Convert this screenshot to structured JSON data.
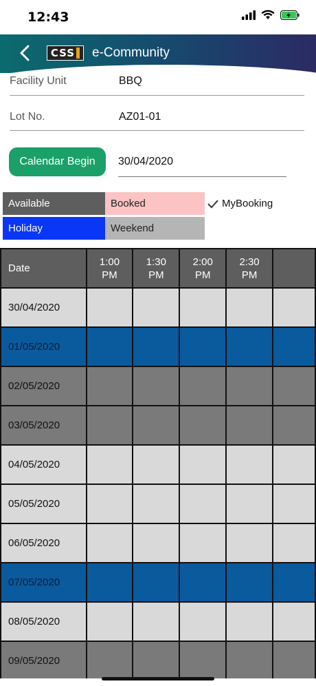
{
  "status_bar": {
    "time": "12:43"
  },
  "header": {
    "title": "e-Community",
    "logo_text": "CSS"
  },
  "form": {
    "facility_unit": {
      "label": "Facility Unit",
      "value": "BBQ"
    },
    "lot_no": {
      "label": "Lot No.",
      "value": "AZ01-01"
    }
  },
  "calendar": {
    "button_label": "Calendar Begin",
    "date": "30/04/2020"
  },
  "legend": {
    "available": "Available",
    "booked": "Booked",
    "mybooking": "MyBooking",
    "holiday": "Holiday",
    "weekend": "Weekend"
  },
  "colors": {
    "header_start": "#0b6b6e",
    "header_end": "#2c2a63",
    "button_green": "#1aa068",
    "available": "#5e5e5e",
    "booked": "#fbc3c3",
    "holiday": "#0a36f5",
    "holiday_row": "#0a5a9e",
    "weekend": "#b5b5b5",
    "weekend_row": "#7a7a7a"
  },
  "grid": {
    "date_header": "Date",
    "time_slots": [
      {
        "line1": "1:00",
        "line2": "PM"
      },
      {
        "line1": "1:30",
        "line2": "PM"
      },
      {
        "line1": "2:00",
        "line2": "PM"
      },
      {
        "line1": "2:30",
        "line2": "PM"
      }
    ],
    "rows": [
      {
        "date": "30/04/2020",
        "type": "normal"
      },
      {
        "date": "01/05/2020",
        "type": "holiday"
      },
      {
        "date": "02/05/2020",
        "type": "weekend"
      },
      {
        "date": "03/05/2020",
        "type": "weekend"
      },
      {
        "date": "04/05/2020",
        "type": "normal"
      },
      {
        "date": "05/05/2020",
        "type": "normal"
      },
      {
        "date": "06/05/2020",
        "type": "normal"
      },
      {
        "date": "07/05/2020",
        "type": "holiday"
      },
      {
        "date": "08/05/2020",
        "type": "normal"
      },
      {
        "date": "09/05/2020",
        "type": "weekend"
      }
    ]
  }
}
